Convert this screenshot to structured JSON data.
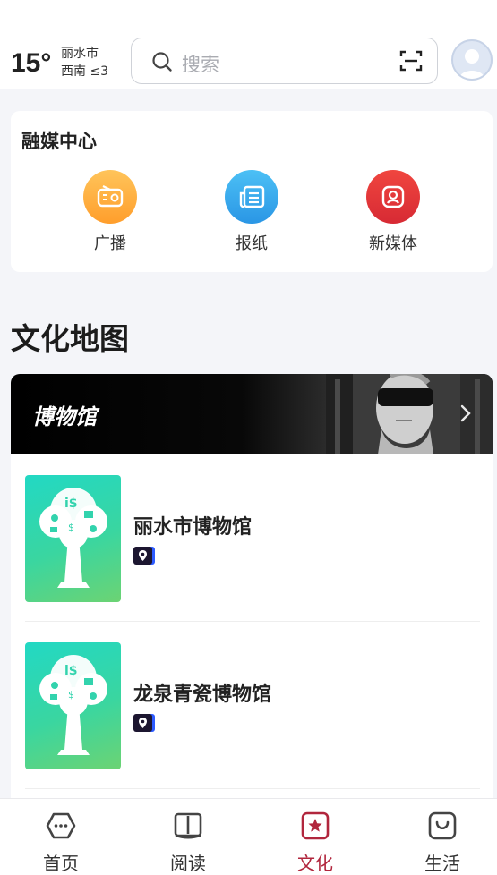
{
  "header": {
    "temperature": "15°",
    "city": "丽水市",
    "wind": "西南 ≤3",
    "search_placeholder": "搜索"
  },
  "media_center": {
    "title": "融媒中心",
    "items": [
      {
        "label": "广播",
        "icon": "radio-icon",
        "color": "#ffae3c"
      },
      {
        "label": "报纸",
        "icon": "newspaper-icon",
        "color": "#35a6ee"
      },
      {
        "label": "新媒体",
        "icon": "new-media-icon",
        "color": "#e3373a"
      }
    ]
  },
  "culture_map": {
    "title": "文化地图",
    "banner_title": "博物馆",
    "museums": [
      {
        "name": "丽水市博物馆"
      },
      {
        "name": "龙泉青瓷博物馆"
      }
    ]
  },
  "bottom_nav": {
    "items": [
      {
        "label": "首页",
        "icon": "home-icon"
      },
      {
        "label": "阅读",
        "icon": "book-icon"
      },
      {
        "label": "文化",
        "icon": "culture-star-icon",
        "active": true
      },
      {
        "label": "生活",
        "icon": "shopping-bag-icon"
      }
    ],
    "active_color": "#b1263d"
  }
}
